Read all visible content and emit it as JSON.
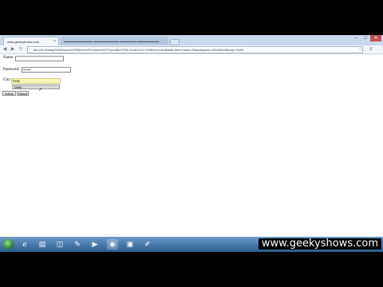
{
  "browser": {
    "tabs": [
      {
        "label": "www.geekyshows.com",
        "close": "×"
      },
      {
        "label": "▬▬▬▬▬▬▬▬▬ ▬▬▬▬▬▬▬▬ ▬▬▬▬▬ ▬▬▬▬▬▬▬"
      }
    ],
    "address": "file:///E:/Geeky%20Shows%20New%20Youtube%20Tutorials/HTML/Code/113.%20Removevalidate.html?name=Rahul&pass=435345435&city=Delhi",
    "window_controls": [
      "–",
      "□",
      "✕"
    ]
  },
  "form": {
    "name_label": "Name:",
    "name_value": "",
    "password_label": "Password:",
    "password_value": "•••••••",
    "city_label": "City:",
    "city_value": "Delhi",
    "suggestion": "Delhi",
    "submit_label": "Submit",
    "reset_label": "Submit"
  },
  "taskbar": {
    "icons": [
      "ie-icon",
      "folder-icon",
      "library-icon",
      "paint-icon",
      "media-player-icon",
      "chrome-icon",
      "powerpoint-icon",
      "notepad-icon"
    ]
  },
  "watermark": "www.geekyshows.com"
}
